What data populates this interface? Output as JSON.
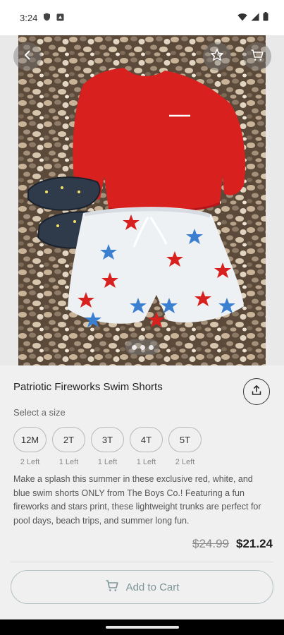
{
  "status_bar": {
    "time": "3:24"
  },
  "product": {
    "title": "Patriotic Fireworks Swim Shorts",
    "size_label": "Select a size",
    "sizes": [
      {
        "label": "12M",
        "stock": "2 Left"
      },
      {
        "label": "2T",
        "stock": "1 Left"
      },
      {
        "label": "3T",
        "stock": "1 Left"
      },
      {
        "label": "4T",
        "stock": "1 Left"
      },
      {
        "label": "5T",
        "stock": "2 Left"
      }
    ],
    "description": "Make a splash this summer in these exclusive red, white, and blue swim shorts ONLY from The Boys Co.! Featuring a fun fireworks and stars print, these lightweight trunks are perfect for pool days, beach trips, and summer long fun.",
    "original_price": "$24.99",
    "sale_price": "$21.24"
  },
  "actions": {
    "add_to_cart": "Add to Cart"
  },
  "icons": {
    "back": "back-arrow-icon",
    "favorite": "star-icon",
    "cart": "cart-icon",
    "share": "share-icon"
  },
  "colors": {
    "accent": "#7d9497",
    "shirt": "#d8201f"
  }
}
